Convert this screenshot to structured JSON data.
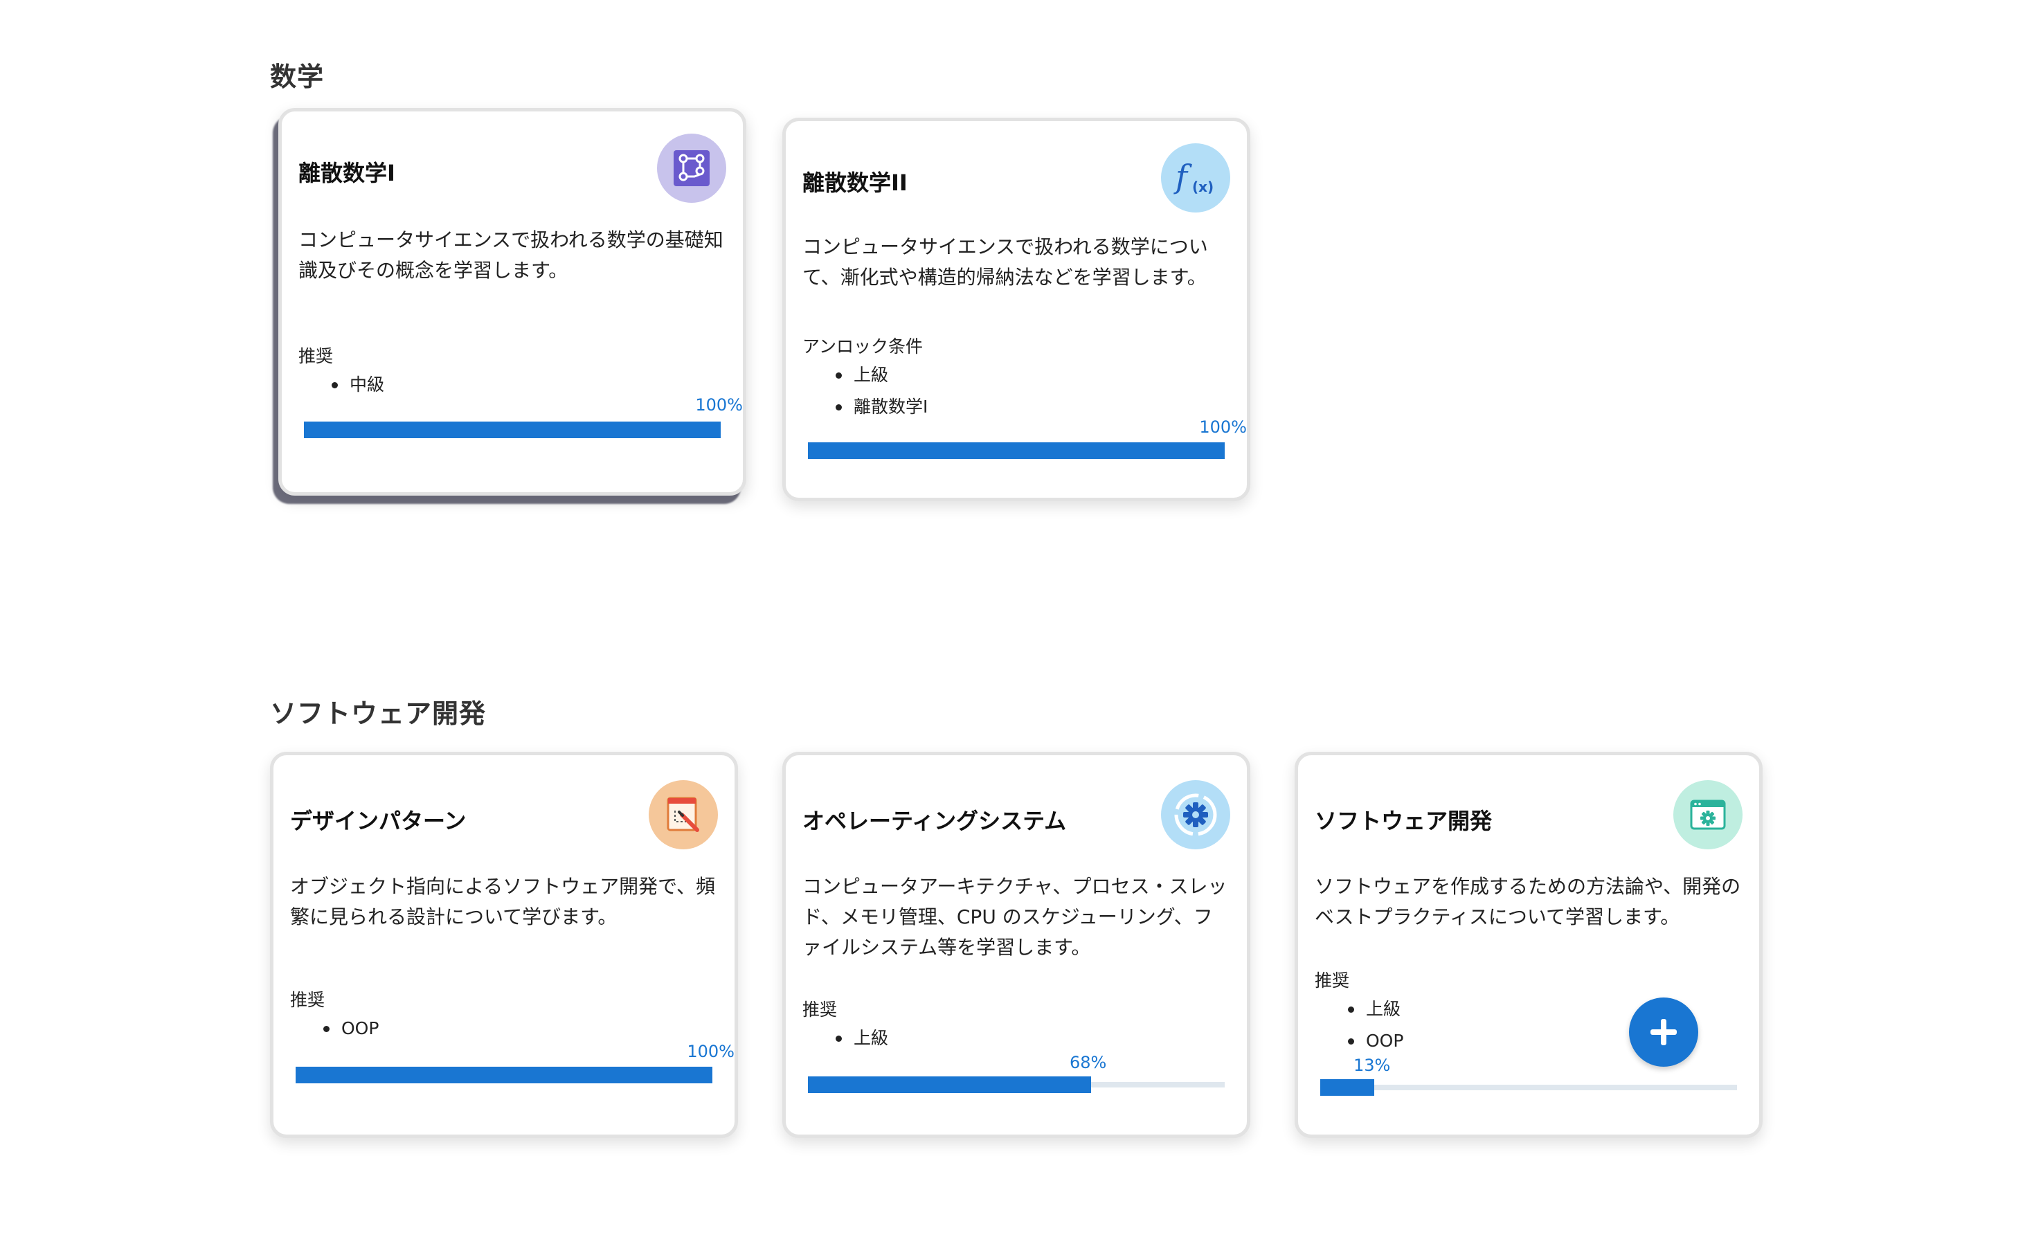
{
  "sections": [
    {
      "title": "数学",
      "cards": [
        {
          "title": "離散数学I",
          "icon": "circuit-chip-icon",
          "description": "コンピュータサイエンスで扱われる数学の基礎知識及びその概念を学習します。",
          "requirement_label": "推奨",
          "requirements": [
            "中級"
          ],
          "progress": 100,
          "progress_text": "100%"
        },
        {
          "title": "離散数学II",
          "icon": "function-fx-icon",
          "description": "コンピュータサイエンスで扱われる数学について、漸化式や構造的帰納法などを学習します。",
          "requirement_label": "アンロック条件",
          "requirements": [
            "上級",
            "離散数学I"
          ],
          "progress": 100,
          "progress_text": "100%"
        }
      ]
    },
    {
      "title": "ソフトウェア開発",
      "cards": [
        {
          "title": "デザインパターン",
          "icon": "design-pencil-icon",
          "description": "オブジェクト指向によるソフトウェア開発で、頻繁に見られる設計について学びます。",
          "requirement_label": "推奨",
          "requirements": [
            "OOP"
          ],
          "progress": 100,
          "progress_text": "100%"
        },
        {
          "title": "オペレーティングシステム",
          "icon": "gear-cycle-icon",
          "description": "コンピュータアーキテクチャ、プロセス・スレッド、メモリ管理、CPU のスケジューリング、ファイルシステム等を学習します。",
          "requirement_label": "推奨",
          "requirements": [
            "上級"
          ],
          "progress": 68,
          "progress_text": "68%"
        },
        {
          "title": "ソフトウェア開発",
          "icon": "browser-gear-icon",
          "description": "ソフトウェアを作成するための方法論や、開発のベストプラクティスについて学習します。",
          "requirement_label": "推奨",
          "requirements": [
            "上級",
            "OOP"
          ],
          "progress": 13,
          "progress_text": "13%"
        }
      ]
    }
  ],
  "add_button": {
    "icon": "plus-icon"
  },
  "colors": {
    "accent": "#1976d2",
    "track": "#dfe7ee",
    "card_border": "#e2e2e2"
  }
}
